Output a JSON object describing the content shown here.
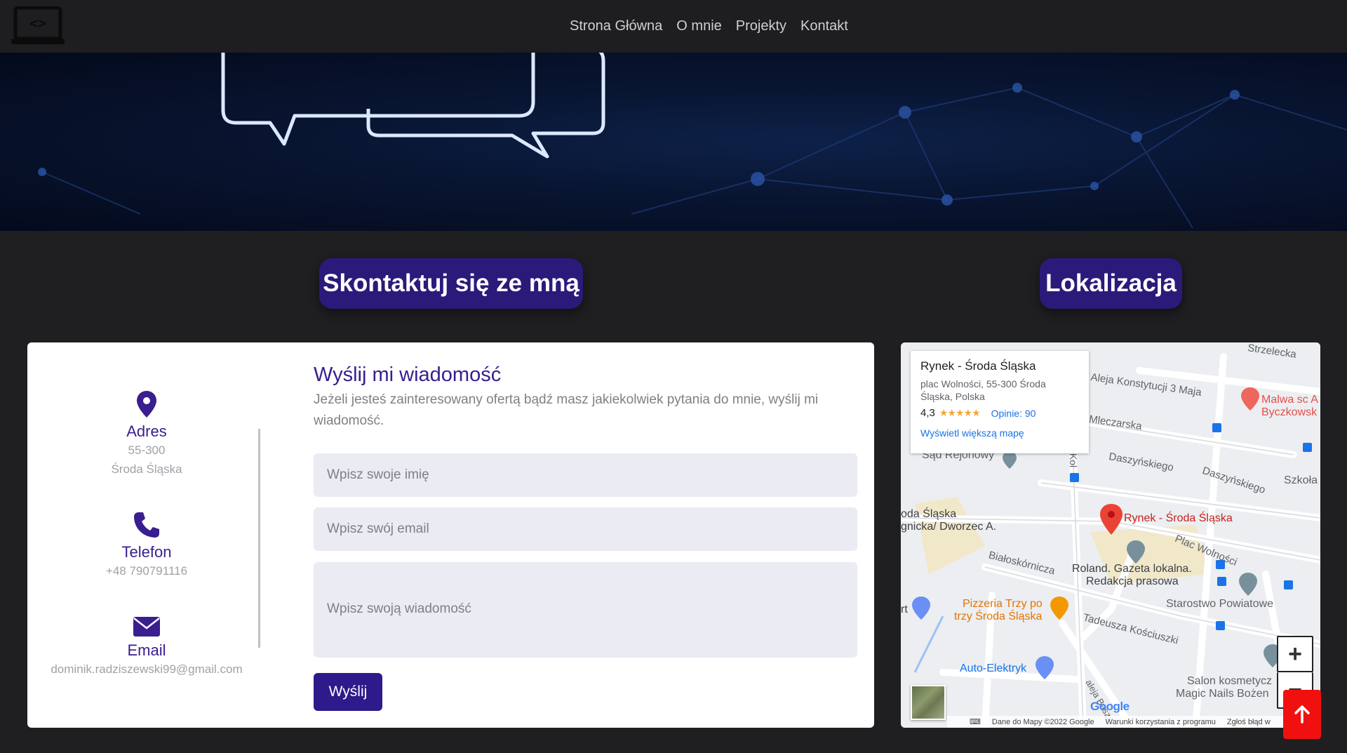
{
  "nav": {
    "items": [
      {
        "label": "Strona Główna"
      },
      {
        "label": "O mnie"
      },
      {
        "label": "Projekty"
      },
      {
        "label": "Kontakt"
      }
    ]
  },
  "sections": {
    "contact_title": "Skontaktuj się ze mną",
    "location_title": "Lokalizacja"
  },
  "contact_info": {
    "address": {
      "title": "Adres",
      "line1": "55-300",
      "line2": "Środa Śląska",
      "icon": "map-pin-icon"
    },
    "phone": {
      "title": "Telefon",
      "value": "+48 790791116",
      "icon": "phone-icon"
    },
    "email": {
      "title": "Email",
      "value": "dominik.radziszewski99@gmail.com",
      "icon": "envelope-icon"
    }
  },
  "form": {
    "title": "Wyślij mi wiadomość",
    "description": "Jeżeli jesteś zainteresowany ofertą bądź masz jakiekolwiek pytania do mnie, wyślij mi wiadomość.",
    "name_placeholder": "Wpisz swoje imię",
    "email_placeholder": "Wpisz swój email",
    "message_placeholder": "Wpisz swoją wiadomość",
    "submit_label": "Wyślij"
  },
  "map": {
    "place_name": "Rynek - Środa Śląska",
    "place_address": "plac Wolności, 55-300 Środa Śląska, Polska",
    "rating": "4,3",
    "stars": "★★★★★",
    "reviews": "Opinie: 90",
    "larger_map": "Wyświetl większą mapę",
    "labels": {
      "strzelecka": "Strzelecka",
      "konstytucji": "Aleja Konstytucji 3 Maja",
      "malwa": "Malwa sc A",
      "byczkowski": "Byczkowsk",
      "mleczarska": "Mleczarska",
      "sad": "Sąd Rejonowy",
      "daszynskiego1": "Daszyńskiego",
      "daszynskiego2": "Daszyńskiego",
      "szkola": "Szkoła",
      "srodaslaska": "oda Śląska",
      "legnicka": "gnicka/ Dworzec A.",
      "rynek_pin": "Rynek - Środa Śląska",
      "placwolnosci": "Plac Wolności",
      "bialoskornicza": "Białoskórnicza",
      "roland1": "Roland. Gazeta lokalna.",
      "roland2": "Redakcja prasowa",
      "pizzeria1": "Pizzeria Trzy po",
      "pizzeria2": "trzy Środa Śląska",
      "starostwo": "Starostwo Powiatowe",
      "kosciuszki": "Tadeusza Kościuszki",
      "autoelektryk": "Auto-Elektryk",
      "salon1": "Salon kosmetycz",
      "salon2": "Magic Nails Bożen",
      "kol": "Kol",
      "rt": "rt",
      "aleja": "aleja Basz"
    },
    "zoom_in": "+",
    "zoom_out": "−",
    "footer": {
      "data": "Dane do Mapy ©2022 Google",
      "terms": "Warunki korzystania z programu",
      "report": "Zgłoś błąd w"
    },
    "google": "Google"
  },
  "scroll_top": {
    "icon": "arrow-up-icon"
  }
}
